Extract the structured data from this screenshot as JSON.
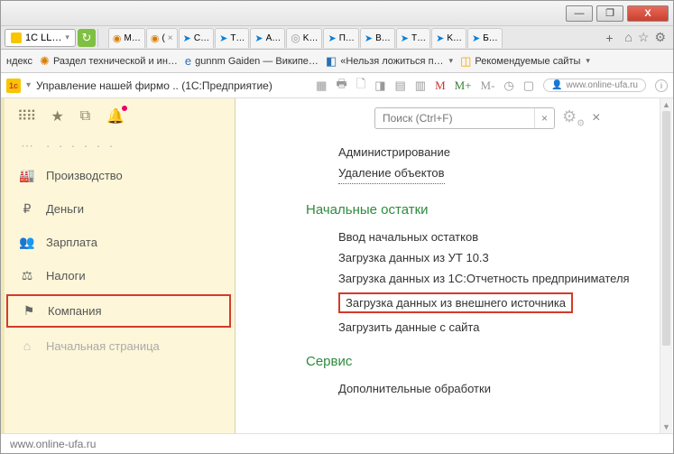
{
  "window": {
    "min": "—",
    "max": "❐",
    "close": "X"
  },
  "address": {
    "label": "1C LL…"
  },
  "tabs": [
    {
      "icon_type": "orange",
      "label": "M…"
    },
    {
      "icon_type": "orange",
      "label": "("
    },
    {
      "icon_type": "blue",
      "label": "C…"
    },
    {
      "icon_type": "blue",
      "label": "T…"
    },
    {
      "icon_type": "blue",
      "label": "A…"
    },
    {
      "icon_type": "grey",
      "label": "K…"
    },
    {
      "icon_type": "blue",
      "label": "П…"
    },
    {
      "icon_type": "blue",
      "label": "B…"
    },
    {
      "icon_type": "blue",
      "label": "T…"
    },
    {
      "icon_type": "blue",
      "label": "K…"
    },
    {
      "icon_type": "blue",
      "label": "Б…"
    }
  ],
  "bookmarks": {
    "b1": "ндекс",
    "b2": "Раздел технической и ин…",
    "b3": "gunnm Gaiden — Википе…",
    "b4": "«Нельзя ложиться п…",
    "b5": "Рекомендуемые сайты"
  },
  "app": {
    "title": "Управление нашей фирмо .. (1С:Предприятие)",
    "user": "www.online-ufa.ru"
  },
  "sidebar": {
    "items": [
      {
        "icon": "🏭",
        "label": "Производство"
      },
      {
        "icon": "₽",
        "label": "Деньги"
      },
      {
        "icon": "👥",
        "label": "Зарплата"
      },
      {
        "icon": "⚖",
        "label": "Налоги"
      },
      {
        "icon": "⚑",
        "label": "Компания",
        "highlight": true
      },
      {
        "icon": "⌂",
        "label": "Начальная страница",
        "dim": true
      }
    ]
  },
  "content": {
    "search_placeholder": "Поиск (Ctrl+F)",
    "top_links": {
      "l1": "Администрирование",
      "l2": "Удаление объектов"
    },
    "section1": {
      "title": "Начальные остатки",
      "links": {
        "l1": "Ввод начальных остатков",
        "l2": "Загрузка данных из УТ 10.3",
        "l3": "Загрузка данных из 1С:Отчетность предпринимателя",
        "l4": "Загрузка данных из внешнего источника",
        "l5": "Загрузить данные с сайта"
      }
    },
    "section2": {
      "title": "Сервис",
      "links": {
        "l1": "Дополнительные обработки"
      }
    }
  },
  "footer": {
    "text": "www.online-ufa.ru"
  }
}
